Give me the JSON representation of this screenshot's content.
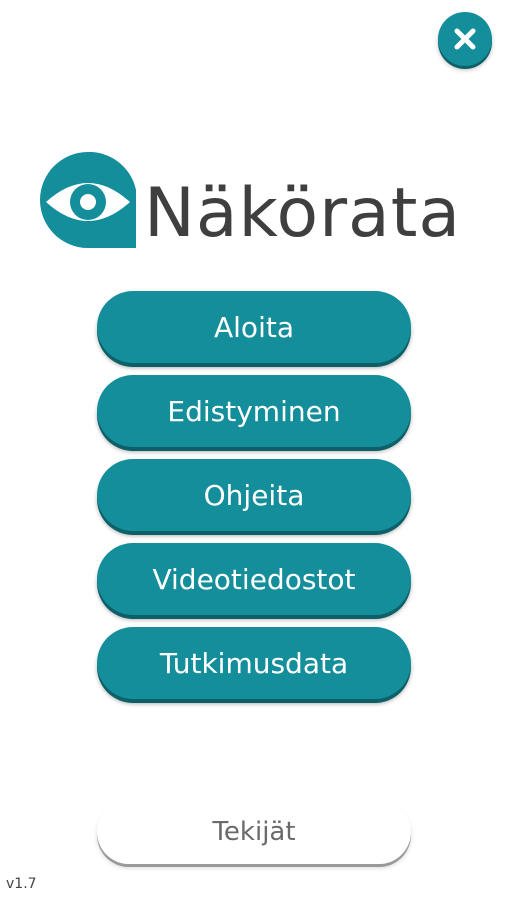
{
  "app": {
    "logo_text": "Näkörata",
    "logo_icon": "eye-icon",
    "close_icon": "close-icon",
    "accent_color": "#138e9a",
    "accent_shadow_color": "#0d5f68",
    "version": "v1.7"
  },
  "menu": {
    "items": [
      {
        "label": "Aloita"
      },
      {
        "label": "Edistyminen"
      },
      {
        "label": "Ohjeita"
      },
      {
        "label": "Videotiedostot"
      },
      {
        "label": "Tutkimusdata"
      }
    ]
  },
  "footer": {
    "credits_label": "Tekijät"
  }
}
